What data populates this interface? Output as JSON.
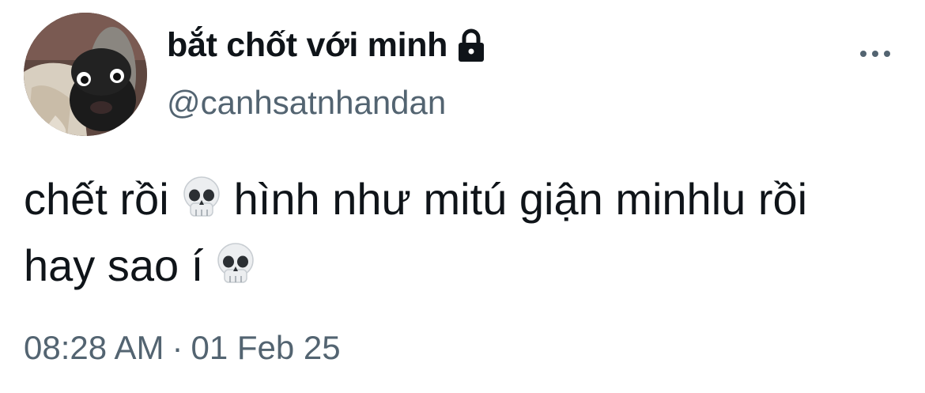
{
  "author": {
    "display_name": "bắt chốt với minh",
    "handle": "@canhsatnhandan",
    "protected_icon": "lock-icon",
    "avatar": "pug-avatar"
  },
  "menu": {
    "icon": "more-horizontal-icon"
  },
  "tweet": {
    "line1_part1": "chết rồi",
    "line1_part2": "hình như mitú giận minhlu rồi",
    "line2_part1": "hay sao í",
    "emoji": "skull-emoji"
  },
  "meta": {
    "time": "08:28 AM",
    "separator": "·",
    "date": "01 Feb 25"
  },
  "colors": {
    "text": "#0f1419",
    "secondary": "#536471",
    "background": "#ffffff"
  }
}
